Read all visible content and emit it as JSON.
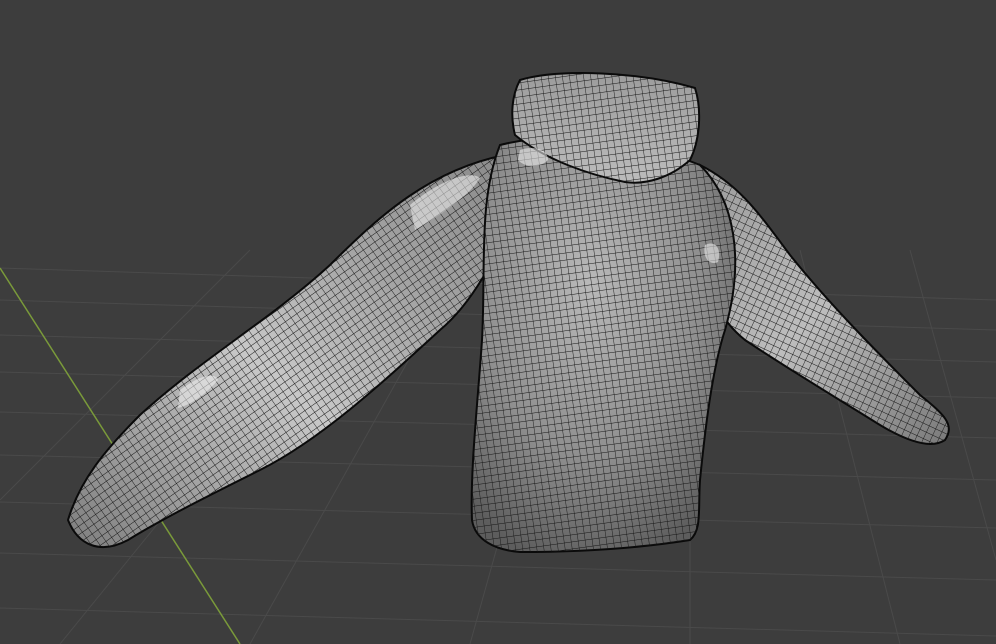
{
  "viewport": {
    "background_color": "#3d3d3d",
    "grid_line_color": "#4a4a4a",
    "axis_y_color": "#7a9a3a"
  },
  "model": {
    "object": "hoodie-mesh",
    "shading": "solid-with-wireframe",
    "surface_color": "#8e8e8e",
    "highlight_color": "#e8e8e8",
    "wire_color": "#111111"
  }
}
